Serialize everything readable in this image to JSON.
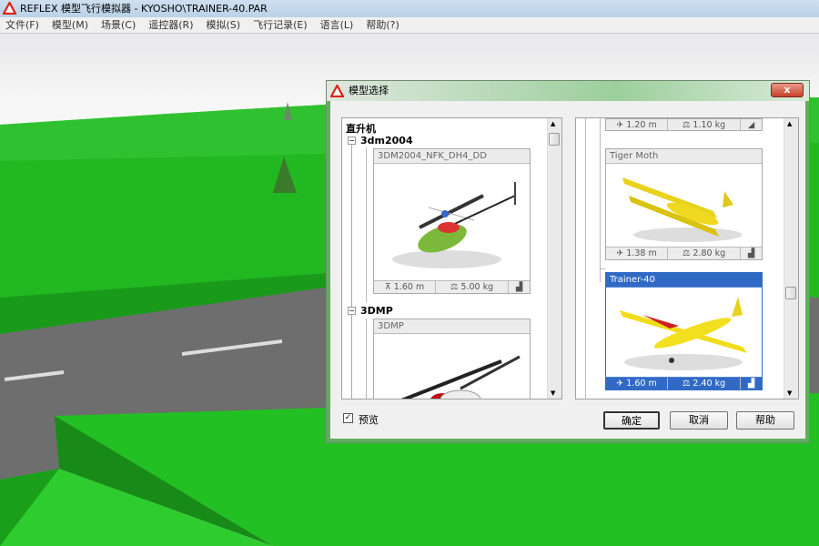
{
  "window": {
    "title": "REFLEX 模型飞行模拟器 - KYOSHO\\TRAINER-40.PAR"
  },
  "menu": [
    "文件(F)",
    "模型(M)",
    "场景(C)",
    "遥控器(R)",
    "模拟(S)",
    "飞行记录(E)",
    "语言(L)",
    "帮助(?)"
  ],
  "dialog": {
    "title": "模型选择",
    "close": "x",
    "left": {
      "category": "直升机",
      "groups": [
        {
          "name": "3dm2004",
          "model": "3DM2004_NFK_DH4_DD",
          "span": "1.60 m",
          "weight": "5.00 kg"
        },
        {
          "name": "3DMP",
          "model": "3DMP"
        }
      ]
    },
    "right": {
      "top_stats": {
        "span": "1.20 m",
        "weight": "1.10 kg"
      },
      "models": [
        {
          "name": "Tiger Moth",
          "span": "1.38 m",
          "weight": "2.80 kg"
        },
        {
          "name": "Trainer-40",
          "span": "1.60 m",
          "weight": "2.40 kg",
          "selected": true
        }
      ]
    },
    "preview_label": "预览",
    "preview_checked": true,
    "ok": "确定",
    "cancel": "取消",
    "help": "帮助"
  },
  "colors": {
    "selection": "#316ac5",
    "grass": "#1fb81f"
  }
}
